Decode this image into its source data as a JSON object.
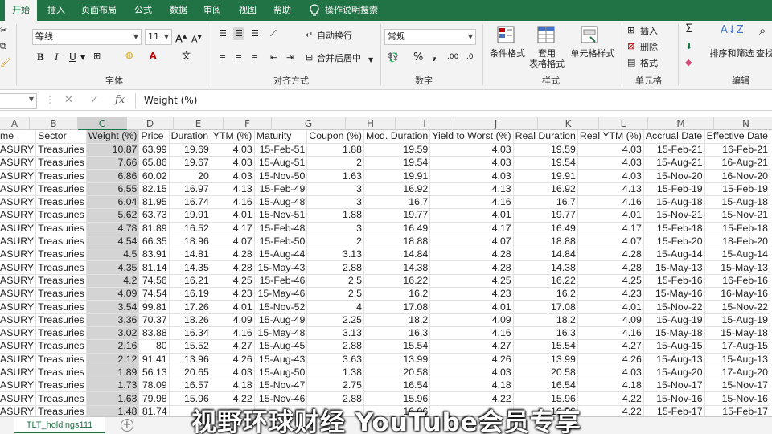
{
  "ribbon_tabs": [
    "开始",
    "插入",
    "页面布局",
    "公式",
    "数据",
    "审阅",
    "视图",
    "帮助",
    "操作说明搜索"
  ],
  "font": {
    "name": "等线",
    "size": "11",
    "grow": "A",
    "shrink": "A",
    "bold": "B",
    "italic": "I",
    "underline": "U",
    "group_label": "字体"
  },
  "alignment": {
    "wrap_text": "自动换行",
    "merge_center": "合并后居中",
    "group_label": "对齐方式"
  },
  "number": {
    "format": "常规",
    "percent": "%",
    "comma": ",",
    "increase_decimal": ".00",
    "decrease_decimal": ".0",
    "group_label": "数字"
  },
  "styles": {
    "conditional": "条件格式",
    "as_table_1": "套用",
    "as_table_2": "表格格式",
    "cell_styles": "单元格样式",
    "group_label": "样式"
  },
  "cells": {
    "insert": "插入",
    "delete": "删除",
    "format": "格式",
    "group_label": "单元格"
  },
  "editing": {
    "sort_filter": "排序和筛选",
    "find": "查找",
    "group_label": "编辑"
  },
  "formula_bar": {
    "fx": "fx",
    "content": "Weight (%)"
  },
  "columns": [
    "A",
    "B",
    "C",
    "D",
    "E",
    "F",
    "G",
    "H",
    "I",
    "J",
    "K",
    "L",
    "M",
    "N"
  ],
  "table": {
    "header": [
      "me",
      "Sector",
      "Weight (%)",
      "Price",
      "Duration",
      "YTM (%)",
      "Maturity",
      "Coupon (%)",
      "Mod. Duration",
      "Yield to Worst (%)",
      "Real Duration",
      "Real YTM (%)",
      "Accrual Date",
      "Effective Date"
    ],
    "rows": [
      [
        "ASURY",
        "Treasuries",
        "10.87",
        "63.99",
        "19.69",
        "4.03",
        "15-Feb-51",
        "1.88",
        "19.59",
        "4.03",
        "19.59",
        "4.03",
        "15-Feb-21",
        "16-Feb-21"
      ],
      [
        "ASURY",
        "Treasuries",
        "7.66",
        "65.86",
        "19.67",
        "4.03",
        "15-Aug-51",
        "2",
        "19.54",
        "4.03",
        "19.54",
        "4.03",
        "15-Aug-21",
        "16-Aug-21"
      ],
      [
        "ASURY",
        "Treasuries",
        "6.86",
        "60.02",
        "20",
        "4.03",
        "15-Nov-50",
        "1.63",
        "19.91",
        "4.03",
        "19.91",
        "4.03",
        "15-Nov-20",
        "16-Nov-20"
      ],
      [
        "ASURY",
        "Treasuries",
        "6.55",
        "82.15",
        "16.97",
        "4.13",
        "15-Feb-49",
        "3",
        "16.92",
        "4.13",
        "16.92",
        "4.13",
        "15-Feb-19",
        "15-Feb-19"
      ],
      [
        "ASURY",
        "Treasuries",
        "6.04",
        "81.95",
        "16.74",
        "4.16",
        "15-Aug-48",
        "3",
        "16.7",
        "4.16",
        "16.7",
        "4.16",
        "15-Aug-18",
        "15-Aug-18"
      ],
      [
        "ASURY",
        "Treasuries",
        "5.62",
        "63.73",
        "19.91",
        "4.01",
        "15-Nov-51",
        "1.88",
        "19.77",
        "4.01",
        "19.77",
        "4.01",
        "15-Nov-21",
        "15-Nov-21"
      ],
      [
        "ASURY",
        "Treasuries",
        "4.78",
        "81.89",
        "16.52",
        "4.17",
        "15-Feb-48",
        "3",
        "16.49",
        "4.17",
        "16.49",
        "4.17",
        "15-Feb-18",
        "15-Feb-18"
      ],
      [
        "ASURY",
        "Treasuries",
        "4.54",
        "66.35",
        "18.96",
        "4.07",
        "15-Feb-50",
        "2",
        "18.88",
        "4.07",
        "18.88",
        "4.07",
        "15-Feb-20",
        "18-Feb-20"
      ],
      [
        "ASURY",
        "Treasuries",
        "4.5",
        "83.91",
        "14.81",
        "4.28",
        "15-Aug-44",
        "3.13",
        "14.84",
        "4.28",
        "14.84",
        "4.28",
        "15-Aug-14",
        "15-Aug-14"
      ],
      [
        "ASURY",
        "Treasuries",
        "4.35",
        "81.14",
        "14.35",
        "4.28",
        "15-May-43",
        "2.88",
        "14.38",
        "4.28",
        "14.38",
        "4.28",
        "15-May-13",
        "15-May-13"
      ],
      [
        "ASURY",
        "Treasuries",
        "4.2",
        "74.56",
        "16.21",
        "4.25",
        "15-Feb-46",
        "2.5",
        "16.22",
        "4.25",
        "16.22",
        "4.25",
        "15-Feb-16",
        "16-Feb-16"
      ],
      [
        "ASURY",
        "Treasuries",
        "4.09",
        "74.54",
        "16.19",
        "4.23",
        "15-May-46",
        "2.5",
        "16.2",
        "4.23",
        "16.2",
        "4.23",
        "15-May-16",
        "16-May-16"
      ],
      [
        "ASURY",
        "Treasuries",
        "3.54",
        "99.81",
        "17.26",
        "4.01",
        "15-Nov-52",
        "4",
        "17.08",
        "4.01",
        "17.08",
        "4.01",
        "15-Nov-22",
        "15-Nov-22"
      ],
      [
        "ASURY",
        "Treasuries",
        "3.36",
        "70.37",
        "18.26",
        "4.09",
        "15-Aug-49",
        "2.25",
        "18.2",
        "4.09",
        "18.2",
        "4.09",
        "15-Aug-19",
        "15-Aug-19"
      ],
      [
        "ASURY",
        "Treasuries",
        "3.02",
        "83.88",
        "16.34",
        "4.16",
        "15-May-48",
        "3.13",
        "16.3",
        "4.16",
        "16.3",
        "4.16",
        "15-May-18",
        "15-May-18"
      ],
      [
        "ASURY",
        "Treasuries",
        "2.16",
        "80",
        "15.52",
        "4.27",
        "15-Aug-45",
        "2.88",
        "15.54",
        "4.27",
        "15.54",
        "4.27",
        "15-Aug-15",
        "17-Aug-15"
      ],
      [
        "ASURY",
        "Treasuries",
        "2.12",
        "91.41",
        "13.96",
        "4.26",
        "15-Aug-43",
        "3.63",
        "13.99",
        "4.26",
        "13.99",
        "4.26",
        "15-Aug-13",
        "15-Aug-13"
      ],
      [
        "ASURY",
        "Treasuries",
        "1.89",
        "56.13",
        "20.65",
        "4.03",
        "15-Aug-50",
        "1.38",
        "20.58",
        "4.03",
        "20.58",
        "4.03",
        "15-Aug-20",
        "17-Aug-20"
      ],
      [
        "ASURY",
        "Treasuries",
        "1.73",
        "78.09",
        "16.57",
        "4.18",
        "15-Nov-47",
        "2.75",
        "16.54",
        "4.18",
        "16.54",
        "4.18",
        "15-Nov-17",
        "15-Nov-17"
      ],
      [
        "ASURY",
        "Treasuries",
        "1.63",
        "79.98",
        "15.96",
        "4.22",
        "15-Nov-46",
        "2.88",
        "15.96",
        "4.22",
        "15.96",
        "4.22",
        "15-Nov-16",
        "15-Nov-16"
      ],
      [
        "ASURY",
        "Treasuries",
        "1.48",
        "81.74",
        "",
        "",
        "",
        "",
        "16.06",
        "",
        "16.06",
        "4.22",
        "15-Feb-17",
        "15-Feb-17"
      ]
    ]
  },
  "sheet_tab": "TLT_holdings111",
  "add_sheet": "+",
  "watermark": "视野环球财经 YouTube会员专享",
  "colors": {
    "accent": "#217346",
    "selected_column": "#d4d4d4"
  }
}
